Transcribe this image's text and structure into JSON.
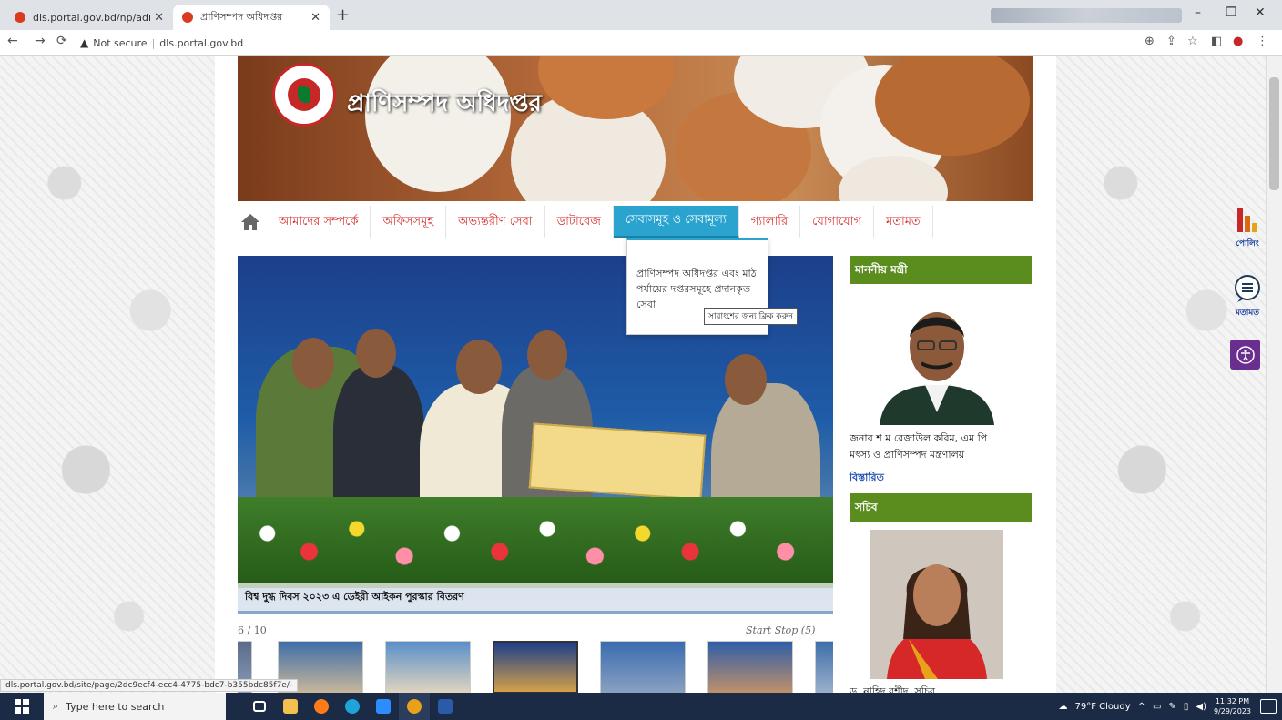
{
  "browser": {
    "tabs": [
      {
        "title": "dls.portal.gov.bd/np/admin/pu...",
        "active": false
      },
      {
        "title": "প্রাণিসম্পদ অধিদপ্তর",
        "active": true
      }
    ],
    "new_tab": "+",
    "address": {
      "security": "Not secure",
      "url": "dls.portal.gov.bd"
    },
    "window_controls": [
      "–",
      "❐",
      "✕"
    ]
  },
  "site": {
    "title": "প্রাণিসম্পদ অধিদপ্তর",
    "menu": [
      {
        "label": "আমাদের সম্পর্কে"
      },
      {
        "label": "অফিসসমূহ"
      },
      {
        "label": "অভ্যন্তরীণ সেবা"
      },
      {
        "label": "ডাটাবেজ"
      },
      {
        "label": "সেবাসমূহ ও সেবামূল্য",
        "active": true
      },
      {
        "label": "গ্যালারি"
      },
      {
        "label": "যোগাযোগ"
      },
      {
        "label": "মতামত"
      }
    ],
    "dropdown": {
      "text": "প্রাণিসম্পদ অধিদপ্তর এবং মাঠ পর্যায়ের দপ্তরসমূহে প্রদানকৃত সেবা",
      "tooltip": "সারাংশের জন্য ক্লিক করুন"
    },
    "slider": {
      "caption": "বিশ্ব দুগ্ধ দিবস ২০২৩ এ ডেইরী আইকন পুরস্কার বিতরণ",
      "counter": "6 / 10",
      "controls": "Start Stop (5)"
    },
    "sidebar": {
      "minister_heading": "মাননীয় মন্ত্রী",
      "minister_name": "জনাব শ ম রেজাউল করিম, এম পি",
      "minister_ministry": "মৎস্য ও প্রাণিসম্পদ মন্ত্রণালয়",
      "details_link": "বিস্তারিত",
      "secretary_heading": "সচিব",
      "secretary_name": "ড. নাহিদ রশীদ, সচিব"
    },
    "floating": {
      "polling": "পোলিং",
      "feedback": "মতামত"
    }
  },
  "status_url": "dls.portal.gov.bd/site/page/2dc9ecf4-ecc4-4775-bdc7-b355bdc85f7e/-",
  "taskbar": {
    "search_placeholder": "Type here to search",
    "weather": "79°F Cloudy",
    "time": "11:32 PM",
    "date": "9/29/2023"
  },
  "colors": {
    "menu_active": "#2aa4cf",
    "menu_text": "#d62b2b",
    "sidebar_heading": "#5a8c1e",
    "taskbar": "#1b2b45"
  }
}
